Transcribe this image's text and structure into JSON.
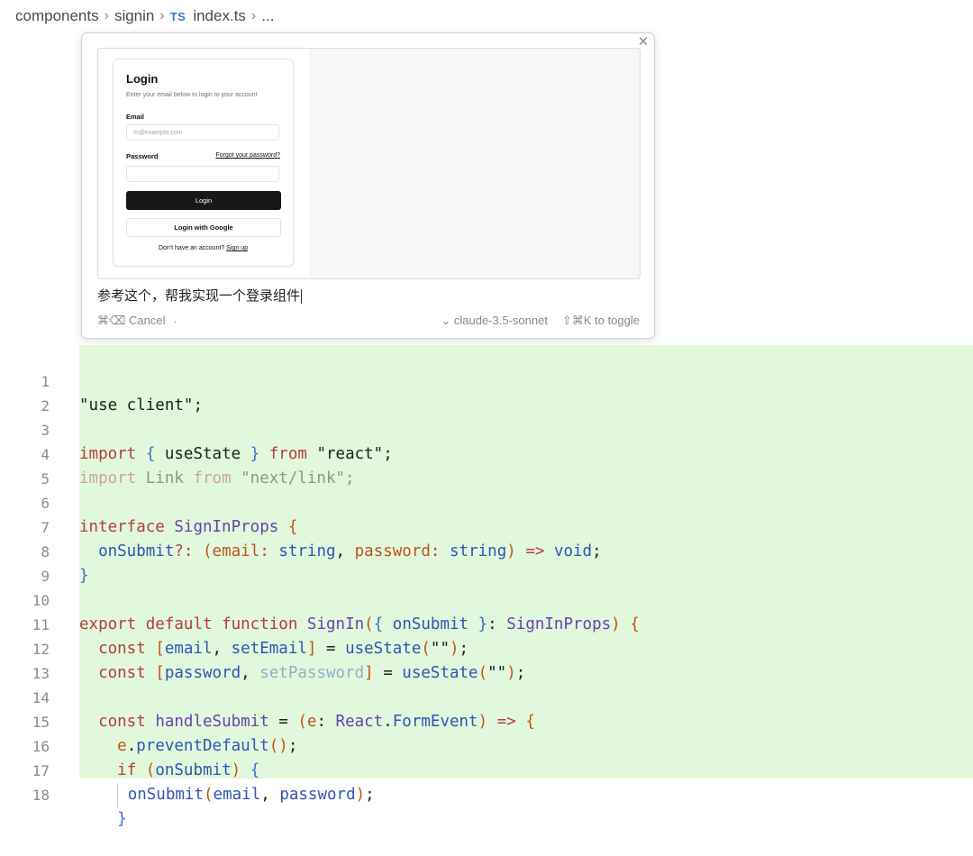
{
  "breadcrumb": {
    "items": [
      "components",
      "signin",
      "index.ts",
      "..."
    ],
    "file_badge": "TS"
  },
  "prompt_panel": {
    "image": {
      "title": "Login",
      "description": "Enter your email below to login to your account",
      "email_label": "Email",
      "email_placeholder": "m@example.com",
      "password_label": "Password",
      "forgot_link": "Forgot your password?",
      "login_button": "Login",
      "google_button": "Login with Google",
      "signup_text": "Don't have an account?",
      "signup_link": "Sign up"
    },
    "prompt_text": "参考这个，帮我实现一个登录组件",
    "cancel_label": "⌘⌫ Cancel",
    "model_label": "⌄ claude-3.5-sonnet",
    "toggle_label": "⇧⌘K to toggle",
    "dot": "."
  },
  "editor": {
    "line_numbers": [
      "1",
      "2",
      "3",
      "4",
      "5",
      "6",
      "7",
      "8",
      "9",
      "10",
      "11",
      "12",
      "13",
      "14",
      "15",
      "16",
      "17",
      "18"
    ]
  }
}
